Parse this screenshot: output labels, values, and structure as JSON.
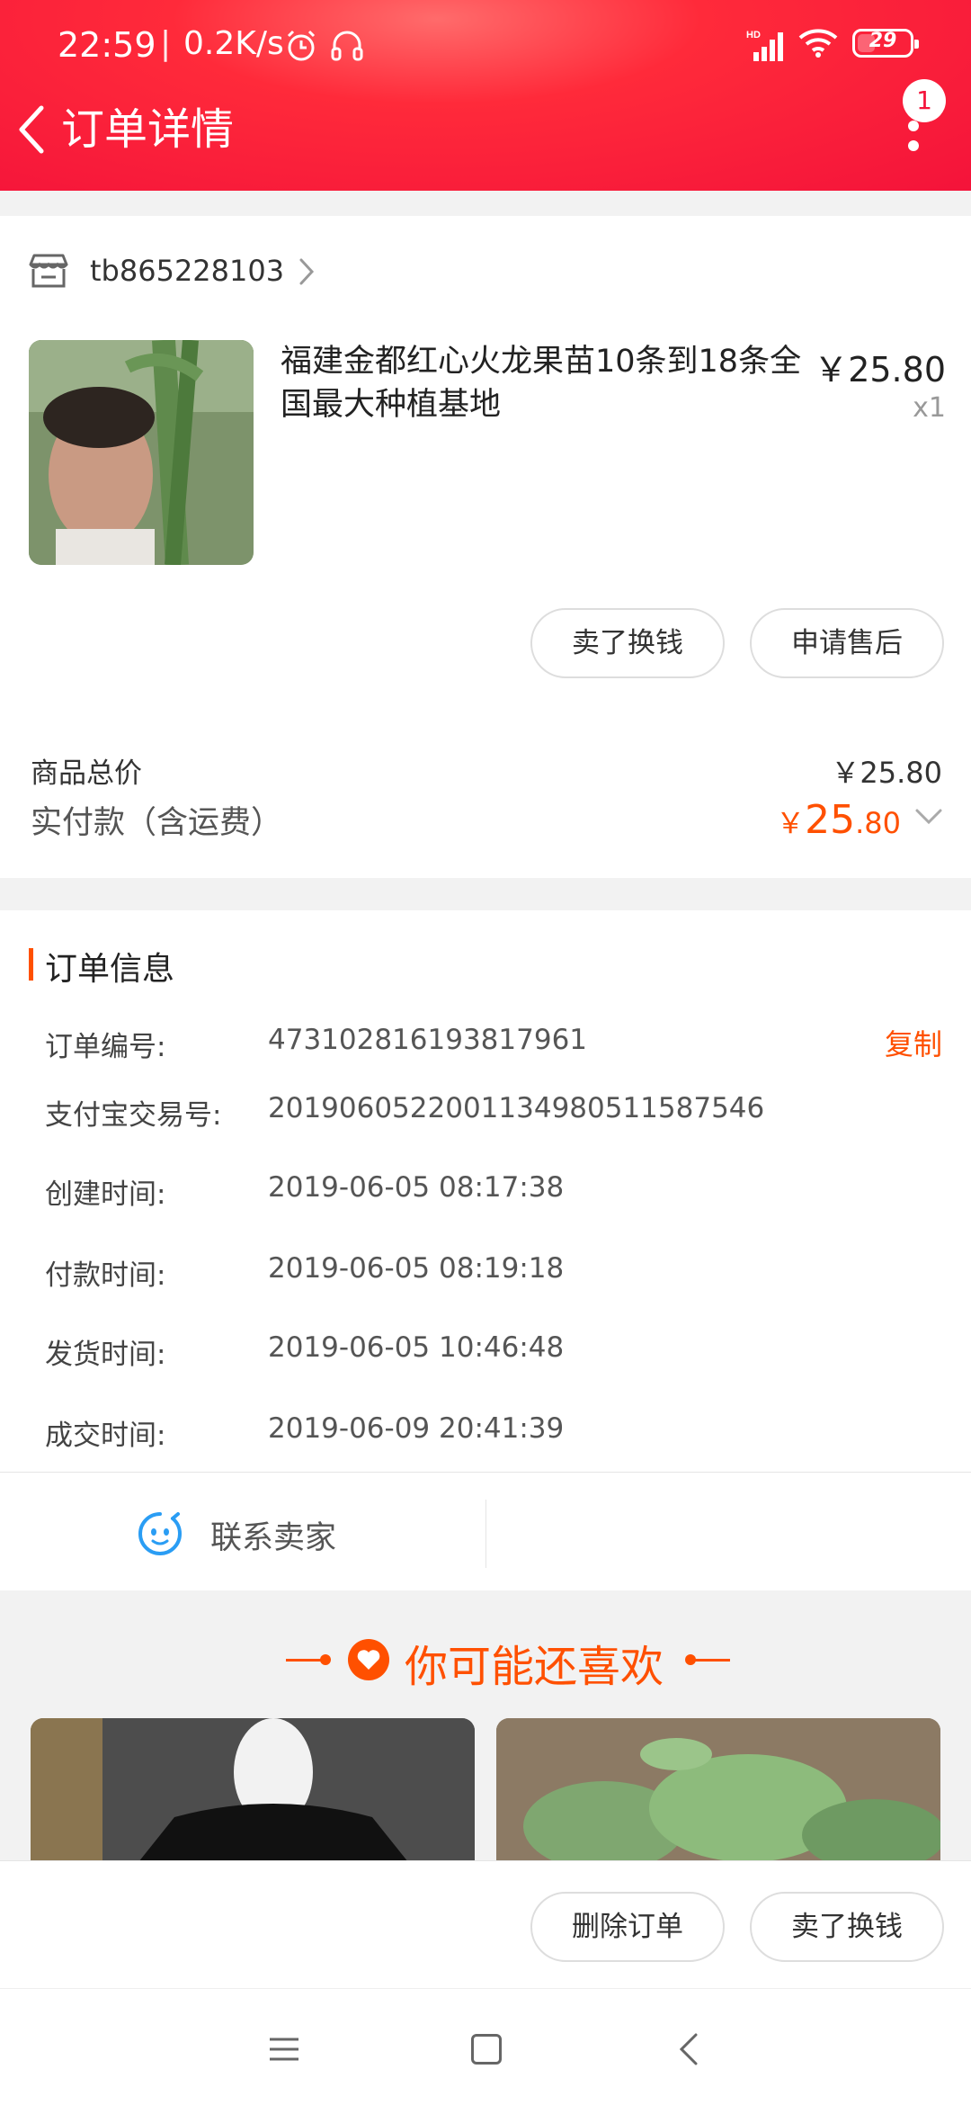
{
  "status_bar": {
    "time": "22:59",
    "separator": "|",
    "net_speed": "0.2K/s",
    "battery": "29"
  },
  "header": {
    "title": "订单详情",
    "notification_count": "1"
  },
  "shop": {
    "name": "tb865228103"
  },
  "product": {
    "title": "福建金都红心火龙果苗10条到18条全国最大种植基地",
    "price": "￥25.80",
    "quantity": "x1"
  },
  "item_actions": {
    "sell_label": "卖了换钱",
    "after_sale_label": "申请售后"
  },
  "summary": {
    "total_label": "商品总价",
    "total_value": "￥25.80",
    "paid_label": "实付款（含运费）",
    "paid_currency": "￥",
    "paid_integer": "25",
    "paid_decimal": ".80"
  },
  "order_info": {
    "title": "订单信息",
    "copy_label": "复制",
    "rows": [
      {
        "label": "订单编号:",
        "value": "473102816193817961"
      },
      {
        "label": "支付宝交易号:",
        "value": "2019060522001134980511587546"
      },
      {
        "label": "创建时间:",
        "value": "2019-06-05 08:17:38"
      },
      {
        "label": "付款时间:",
        "value": "2019-06-05 08:19:18"
      },
      {
        "label": "发货时间:",
        "value": "2019-06-05 10:46:48"
      },
      {
        "label": "成交时间:",
        "value": "2019-06-09 20:41:39"
      }
    ],
    "contact_label": "联系卖家"
  },
  "recommend": {
    "title": "你可能还喜欢"
  },
  "bottom_actions": {
    "delete_label": "删除订单",
    "sell_label": "卖了换钱"
  },
  "colors": {
    "brand_red": "#f4133a",
    "accent_orange": "#ff5000",
    "contact_blue": "#2a9df4"
  }
}
